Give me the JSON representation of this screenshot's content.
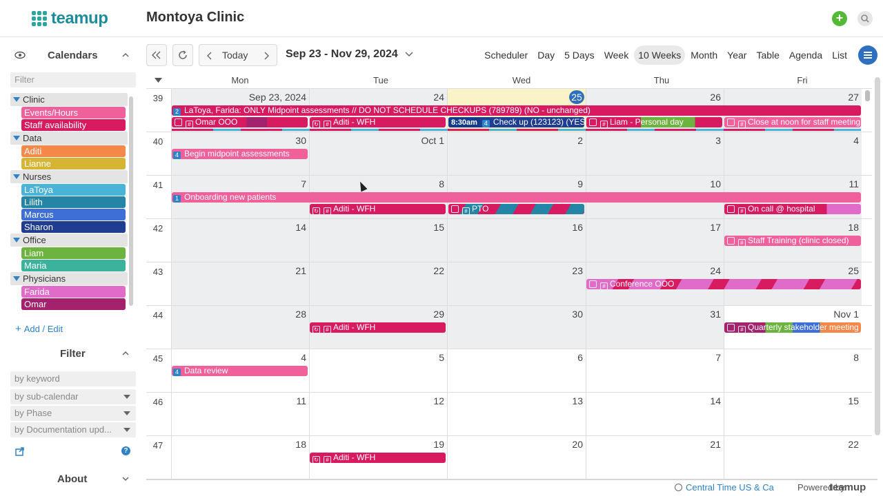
{
  "app": {
    "logo_text": "teamup",
    "title": "Montoya Clinic"
  },
  "sidebar": {
    "calendars_title": "Calendars",
    "filter_placeholder": "Filter",
    "groups": [
      {
        "label": "Clinic",
        "items": [
          {
            "label": "Events/Hours",
            "color": "#f0609b"
          },
          {
            "label": "Staff availability",
            "color": "#d81b60"
          }
        ]
      },
      {
        "label": "Data",
        "items": [
          {
            "label": "Aditi",
            "color": "#f4884a"
          },
          {
            "label": "Lianne",
            "color": "#d6b535"
          }
        ]
      },
      {
        "label": "Nurses",
        "items": [
          {
            "label": "LaToya",
            "color": "#4ab4d8"
          },
          {
            "label": "Lilith",
            "color": "#2585a7"
          },
          {
            "label": "Marcus",
            "color": "#3d6fd6"
          },
          {
            "label": "Sharon",
            "color": "#1f3d91"
          }
        ]
      },
      {
        "label": "Office",
        "items": [
          {
            "label": "Liam",
            "color": "#6db33f"
          },
          {
            "label": "Maria",
            "color": "#3bb39c"
          }
        ]
      },
      {
        "label": "Physicians",
        "items": [
          {
            "label": "Farida",
            "color": "#e06bc8"
          },
          {
            "label": "Omar",
            "color": "#a3216d"
          }
        ]
      }
    ],
    "add_edit": "Add / Edit",
    "filter_title": "Filter",
    "filters": [
      "by keyword",
      "by sub-calendar",
      "by Phase",
      "by Documentation upd..."
    ],
    "about_title": "About"
  },
  "toolbar": {
    "today": "Today",
    "range": "Sep 23 - Nov 29, 2024",
    "views": [
      "Scheduler",
      "Day",
      "5 Days",
      "Week",
      "10 Weeks",
      "Month",
      "Year",
      "Table",
      "Agenda",
      "List"
    ],
    "active_view": "10 Weeks"
  },
  "calendar": {
    "day_headers": [
      "Mon",
      "Tue",
      "Wed",
      "Thu",
      "Fri"
    ],
    "weeks": [
      {
        "num": "39",
        "days": [
          "Sep 23, 2024",
          "24",
          "25",
          "26",
          "27"
        ]
      },
      {
        "num": "40",
        "days": [
          "30",
          "Oct 1",
          "2",
          "3",
          "4"
        ]
      },
      {
        "num": "41",
        "days": [
          "7",
          "8",
          "9",
          "10",
          "11"
        ]
      },
      {
        "num": "42",
        "days": [
          "14",
          "15",
          "16",
          "17",
          "18"
        ]
      },
      {
        "num": "43",
        "days": [
          "21",
          "22",
          "23",
          "24",
          "25"
        ]
      },
      {
        "num": "44",
        "days": [
          "28",
          "29",
          "30",
          "31",
          "Nov 1"
        ]
      },
      {
        "num": "45",
        "days": [
          "4",
          "5",
          "6",
          "7",
          "8"
        ]
      },
      {
        "num": "46",
        "days": [
          "11",
          "12",
          "13",
          "14",
          "15"
        ]
      },
      {
        "num": "47",
        "days": [
          "18",
          "19",
          "20",
          "21",
          "22"
        ]
      }
    ],
    "events": {
      "e1": {
        "badge": "2",
        "title": "LaToya, Farida: ONLY Midpoint assessments // DO NOT SCHEDULE CHECKUPS (789789) (NO - unchanged)"
      },
      "e2": {
        "title": "Omar OOO"
      },
      "e3": {
        "title": "Aditi - WFH"
      },
      "e4": {
        "time": "8:30am",
        "badge": "4",
        "title": "Check up (123123) (YES -"
      },
      "e5": {
        "title": "Liam - Personal day"
      },
      "e6": {
        "title": "Close at noon for staff meeting +"
      },
      "e7": {
        "badge": "4",
        "title": "Begin midpoint assessments"
      },
      "e8": {
        "badge": "1",
        "title": "Onboarding new patients"
      },
      "e9": {
        "title": "Aditi - WFH"
      },
      "e10": {
        "title": "PTO"
      },
      "e11": {
        "title": "On call @ hospital"
      },
      "e12": {
        "title": "Staff Training (clinic closed)"
      },
      "e13": {
        "title": "Conference OOO"
      },
      "e14": {
        "title": "Aditi - WFH"
      },
      "e15": {
        "title": "Quarterly stakeholder meeting"
      },
      "e16": {
        "badge": "4",
        "title": "Data review"
      },
      "e17": {
        "title": "Aditi - WFH"
      }
    }
  },
  "footer": {
    "timezone": "Central Time US & Ca",
    "powered": "Powered by",
    "brand": "teamup"
  }
}
